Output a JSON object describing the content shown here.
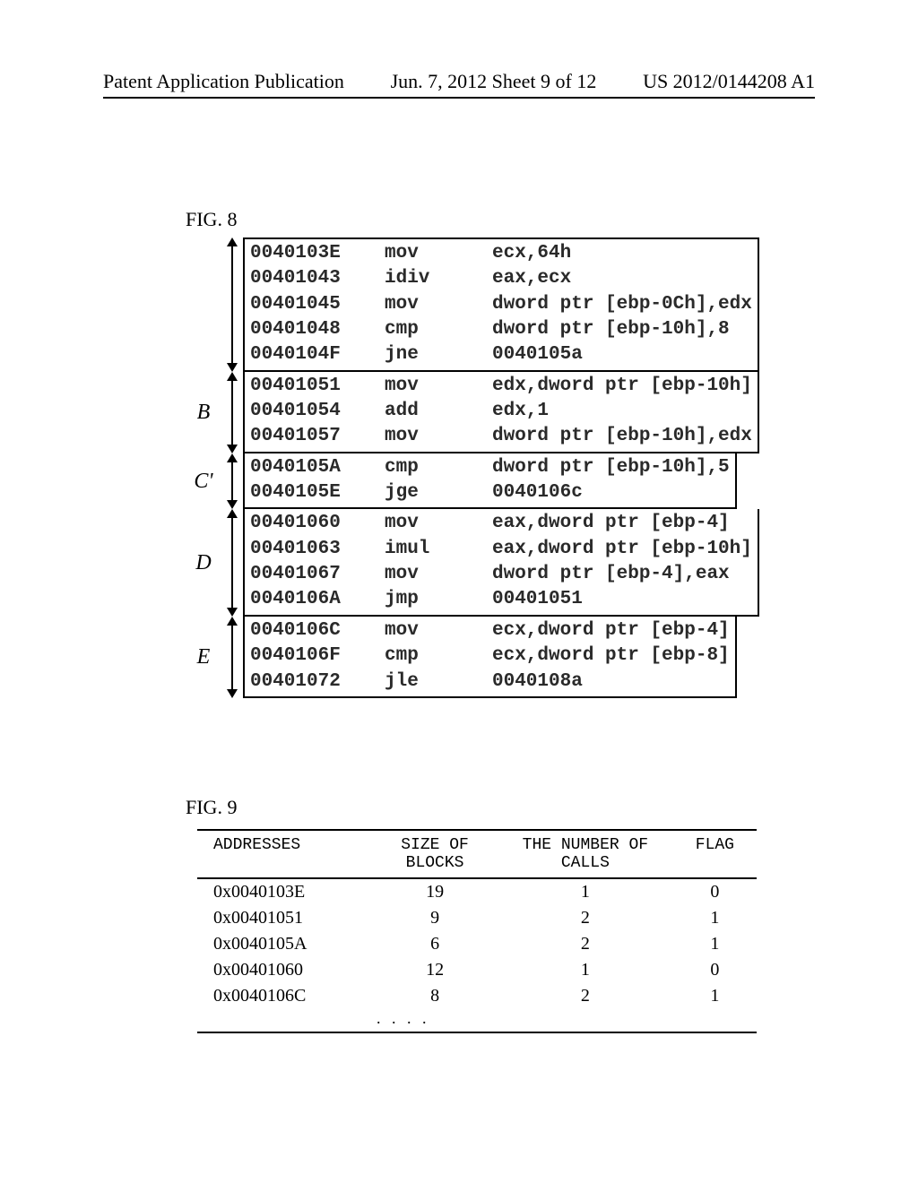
{
  "header": {
    "left": "Patent Application Publication",
    "middle": "Jun. 7, 2012  Sheet 9 of 12",
    "right": "US 2012/0144208 A1"
  },
  "fig8_label": "FIG. 8",
  "fig9_label": "FIG. 9",
  "blocks": [
    {
      "letter": "",
      "rows": [
        {
          "addr": "0040103E",
          "op": "mov",
          "arg": "ecx,64h"
        },
        {
          "addr": "00401043",
          "op": "idiv",
          "arg": "eax,ecx"
        },
        {
          "addr": "00401045",
          "op": "mov",
          "arg": "dword ptr [ebp-0Ch],edx"
        },
        {
          "addr": "00401048",
          "op": "cmp",
          "arg": "dword ptr [ebp-10h],8"
        },
        {
          "addr": "0040104F",
          "op": "jne",
          "arg": "0040105a"
        }
      ]
    },
    {
      "letter": "B",
      "rows": [
        {
          "addr": "00401051",
          "op": "mov",
          "arg": "edx,dword ptr [ebp-10h]"
        },
        {
          "addr": "00401054",
          "op": "add",
          "arg": "edx,1"
        },
        {
          "addr": "00401057",
          "op": "mov",
          "arg": "dword ptr [ebp-10h],edx"
        }
      ]
    },
    {
      "letter": "C'",
      "rows": [
        {
          "addr": "0040105A",
          "op": "cmp",
          "arg": "dword ptr [ebp-10h],5"
        },
        {
          "addr": "0040105E",
          "op": "jge",
          "arg": "0040106c"
        }
      ]
    },
    {
      "letter": "D",
      "rows": [
        {
          "addr": "00401060",
          "op": "mov",
          "arg": "eax,dword ptr [ebp-4]"
        },
        {
          "addr": "00401063",
          "op": "imul",
          "arg": "eax,dword ptr [ebp-10h]"
        },
        {
          "addr": "00401067",
          "op": "mov",
          "arg": "dword ptr [ebp-4],eax"
        },
        {
          "addr": "0040106A",
          "op": "jmp",
          "arg": "00401051"
        }
      ]
    },
    {
      "letter": "E",
      "rows": [
        {
          "addr": "0040106C",
          "op": "mov",
          "arg": "ecx,dword ptr [ebp-4]"
        },
        {
          "addr": "0040106F",
          "op": "cmp",
          "arg": "ecx,dword ptr [ebp-8]"
        },
        {
          "addr": "00401072",
          "op": "jle",
          "arg": "0040108a"
        }
      ]
    }
  ],
  "table": {
    "headers": {
      "addr": "ADDRESSES",
      "size": "SIZE OF BLOCKS",
      "calls": "THE NUMBER OF CALLS",
      "flag": "FLAG"
    },
    "rows": [
      {
        "addr": "0x0040103E",
        "size": "19",
        "calls": "1",
        "flag": "0"
      },
      {
        "addr": "0x00401051",
        "size": "9",
        "calls": "2",
        "flag": "1"
      },
      {
        "addr": "0x0040105A",
        "size": "6",
        "calls": "2",
        "flag": "1"
      },
      {
        "addr": "0x00401060",
        "size": "12",
        "calls": "1",
        "flag": "0"
      },
      {
        "addr": "0x0040106C",
        "size": "8",
        "calls": "2",
        "flag": "1"
      }
    ],
    "ellipsis": ". . . ."
  }
}
